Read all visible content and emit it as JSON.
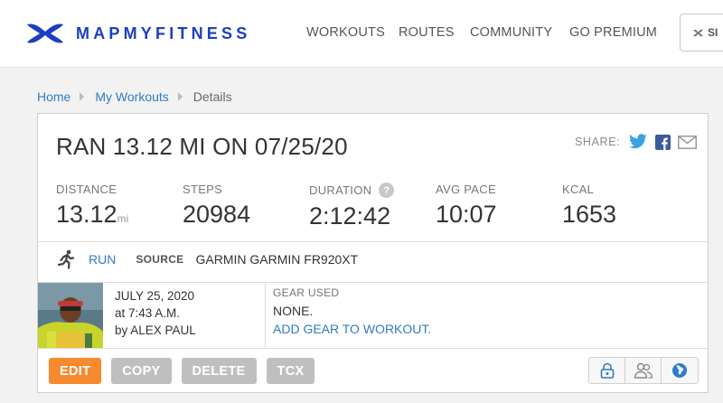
{
  "header": {
    "brand": "MAPMYFITNESS",
    "nav": [
      "WORKOUTS",
      "ROUTES",
      "COMMUNITY",
      "GO PREMIUM"
    ],
    "premium_button": "SI"
  },
  "breadcrumb": {
    "home": "Home",
    "workouts": "My Workouts",
    "current": "Details"
  },
  "workout": {
    "title": "RAN 13.12 MI ON 07/25/20",
    "share_label": "SHARE:",
    "stats": {
      "distance": {
        "label": "DISTANCE",
        "value": "13.12",
        "unit": "mi"
      },
      "steps": {
        "label": "STEPS",
        "value": "20984"
      },
      "duration": {
        "label": "DURATION",
        "value": "2:12:42",
        "help": "?"
      },
      "avg_pace": {
        "label": "AVG PACE",
        "value": "10:07"
      },
      "kcal": {
        "label": "KCAL",
        "value": "1653"
      }
    },
    "activity_type": "RUN",
    "source_label": "SOURCE",
    "source_value": "GARMIN GARMIN FR920XT",
    "date": "JULY 25, 2020",
    "time": "at 7:43 A.M.",
    "by": "by ALEX PAUL",
    "gear_label": "GEAR USED",
    "gear_value": "NONE.",
    "gear_link": "ADD GEAR TO WORKOUT."
  },
  "actions": {
    "edit": "EDIT",
    "copy": "COPY",
    "delete": "DELETE",
    "tcx": "TCX"
  },
  "colors": {
    "brand_blue": "#1d3ec3",
    "link_blue": "#2f7cc4",
    "edit_orange": "#f7892e",
    "button_gray": "#bfbfbf"
  }
}
